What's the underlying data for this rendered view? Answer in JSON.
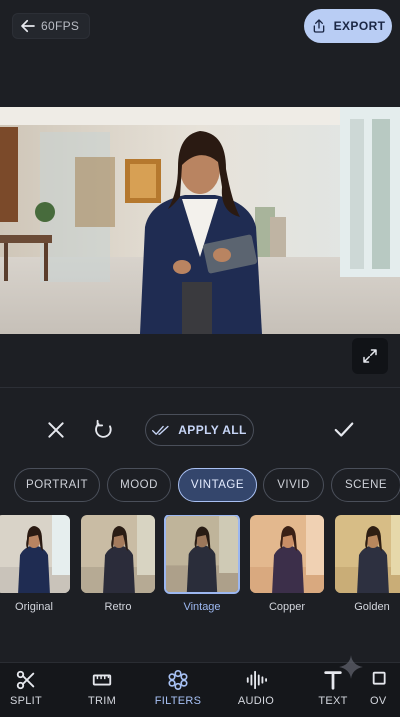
{
  "header": {
    "fps_label": "60FPS",
    "export_label": "EXPORT"
  },
  "actions": {
    "apply_all_label": "APPLY ALL"
  },
  "categories": [
    {
      "label": "PORTRAIT",
      "active": false
    },
    {
      "label": "MOOD",
      "active": false
    },
    {
      "label": "VINTAGE",
      "active": true
    },
    {
      "label": "VIVID",
      "active": false
    },
    {
      "label": "SCENE",
      "active": false
    }
  ],
  "filters": [
    {
      "label": "Original",
      "selected": false
    },
    {
      "label": "Retro",
      "selected": false
    },
    {
      "label": "Vintage",
      "selected": true
    },
    {
      "label": "Copper",
      "selected": false
    },
    {
      "label": "Golden",
      "selected": false
    }
  ],
  "bottom_nav": [
    {
      "label": "SPLIT",
      "icon": "scissors-icon"
    },
    {
      "label": "TRIM",
      "icon": "trim-icon"
    },
    {
      "label": "FILTERS",
      "icon": "filters-icon",
      "active": true
    },
    {
      "label": "AUDIO",
      "icon": "audio-wave-icon"
    },
    {
      "label": "TEXT",
      "icon": "text-icon"
    },
    {
      "label": "OV",
      "icon": "overlay-icon"
    }
  ],
  "colors": {
    "accent": "#a8c2f5",
    "export_bg": "#b9cdf4",
    "background": "#1d1f24"
  }
}
